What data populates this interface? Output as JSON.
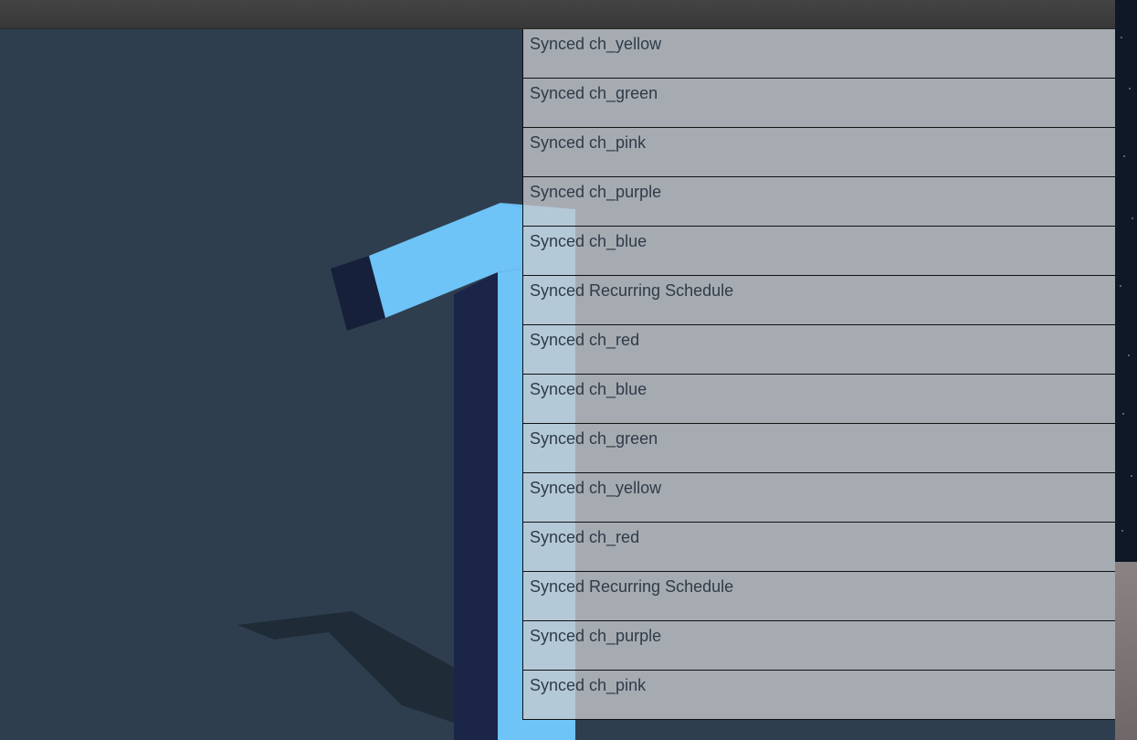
{
  "colors": {
    "background": "#2e3e4f",
    "numeral_face": "#6ec3f7",
    "numeral_side": "#1a2548",
    "shadow": "#1f2b36",
    "list_row": "#c8cbce",
    "list_text": "#2f3b47"
  },
  "viewport": {
    "numeral": "1"
  },
  "sync_list": {
    "items": [
      {
        "label": "Synced ch_yellow"
      },
      {
        "label": "Synced ch_green"
      },
      {
        "label": "Synced ch_pink"
      },
      {
        "label": "Synced ch_purple"
      },
      {
        "label": "Synced ch_blue"
      },
      {
        "label": "Synced Recurring Schedule"
      },
      {
        "label": "Synced ch_red"
      },
      {
        "label": "Synced ch_blue"
      },
      {
        "label": "Synced ch_green"
      },
      {
        "label": "Synced ch_yellow"
      },
      {
        "label": "Synced ch_red"
      },
      {
        "label": "Synced Recurring Schedule"
      },
      {
        "label": "Synced ch_purple"
      },
      {
        "label": "Synced ch_pink"
      }
    ]
  }
}
